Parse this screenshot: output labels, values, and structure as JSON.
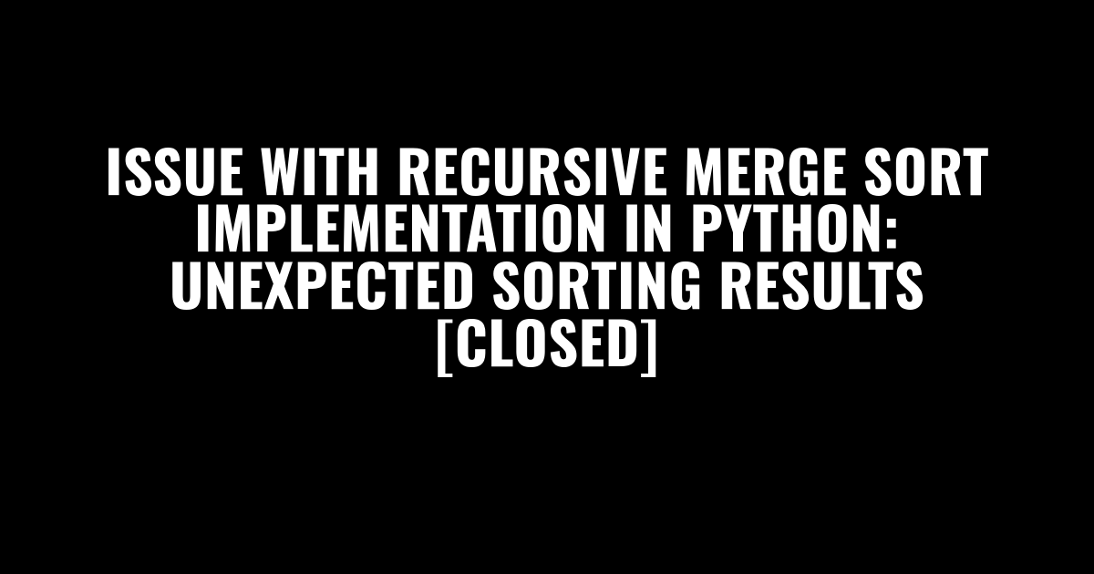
{
  "title": "ISSUE WITH RECURSIVE MERGE SORT IMPLEMENTATION IN PYTHON: UNEXPECTED SORTING RESULTS [CLOSED]"
}
